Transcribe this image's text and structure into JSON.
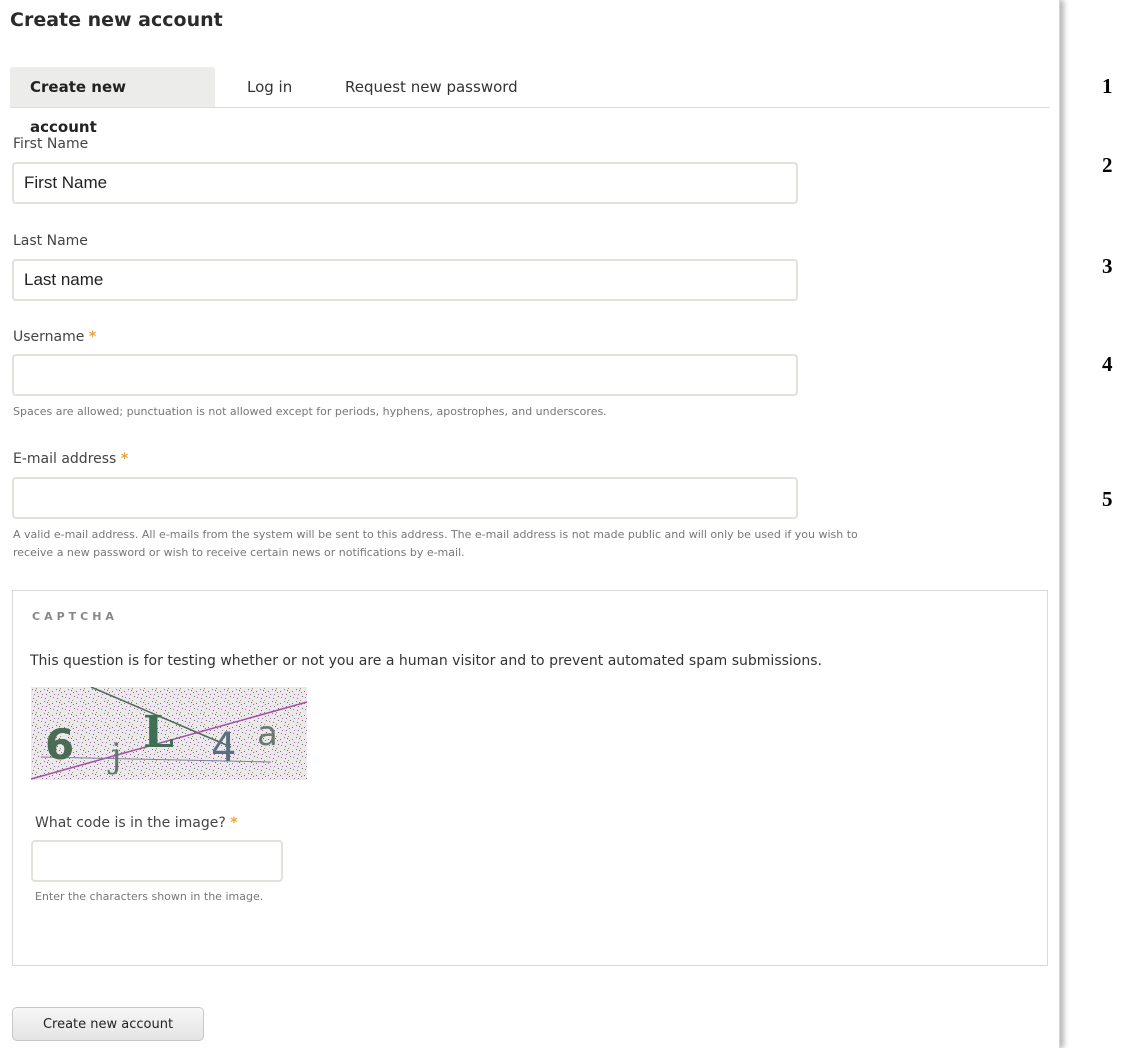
{
  "page": {
    "title": "Create new account"
  },
  "tabs": [
    {
      "label": "Create new account",
      "active": true
    },
    {
      "label": "Log in",
      "active": false
    },
    {
      "label": "Request new password",
      "active": false
    }
  ],
  "fields": {
    "first_name": {
      "label": "First Name",
      "value": "First Name"
    },
    "last_name": {
      "label": "Last Name",
      "value": "Last name"
    },
    "username": {
      "label": "Username",
      "required_mark": "*",
      "value": "",
      "description": "Spaces are allowed; punctuation is not allowed except for periods, hyphens, apostrophes, and underscores."
    },
    "email": {
      "label": "E-mail address",
      "required_mark": "*",
      "value": "",
      "description_line1": "A valid e-mail address. All e-mails from the system will be sent to this address. The e-mail address is not made public and will only be used if you wish to",
      "description_line2": "receive a new password or wish to receive certain news or notifications by e-mail."
    }
  },
  "captcha": {
    "legend": "CAPTCHA",
    "description": "This question is for testing whether or not you are a human visitor and to prevent automated spam submissions.",
    "image_text": "6jL4a",
    "question_label": "What code is in the image?",
    "required_mark": "*",
    "answer": "",
    "help": "Enter the characters shown in the image."
  },
  "submit": {
    "label": "Create new account"
  },
  "side_numbers": [
    "1",
    "2",
    "3",
    "4",
    "5"
  ],
  "colors": {
    "required": "#e8a33d",
    "active_tab_bg": "#ececea"
  }
}
